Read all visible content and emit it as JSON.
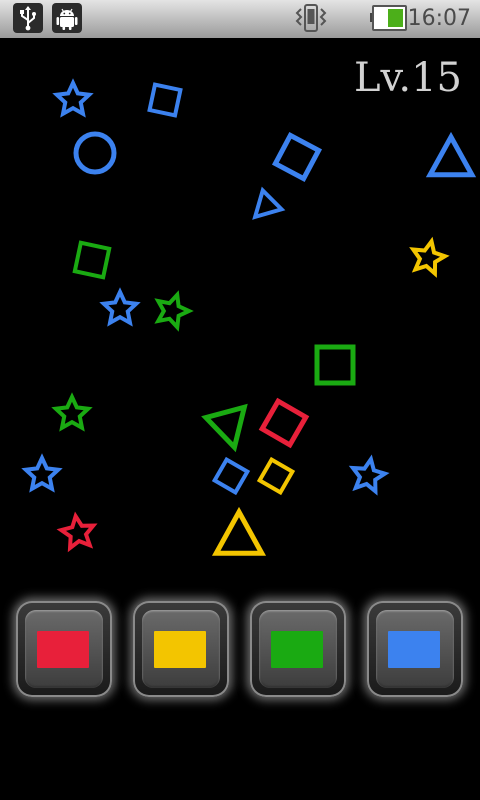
{
  "status_bar": {
    "time": "16:07",
    "icons": [
      "usb-icon",
      "android-debug-icon",
      "vibrate-icon",
      "battery-charging-icon"
    ],
    "battery_color": "#4caf1a"
  },
  "game": {
    "level_text": "Lv.15",
    "colors": {
      "red": "#e8203a",
      "yellow": "#f3c500",
      "green": "#1aaa12",
      "blue": "#3c82ef"
    },
    "shapes": [
      {
        "kind": "star",
        "color": "blue"
      },
      {
        "kind": "square",
        "color": "blue"
      },
      {
        "kind": "circle",
        "color": "blue"
      },
      {
        "kind": "square",
        "color": "blue"
      },
      {
        "kind": "triangle",
        "color": "blue"
      },
      {
        "kind": "triangle",
        "color": "blue"
      },
      {
        "kind": "star",
        "color": "yellow"
      },
      {
        "kind": "square",
        "color": "green"
      },
      {
        "kind": "star",
        "color": "blue"
      },
      {
        "kind": "star",
        "color": "green"
      },
      {
        "kind": "square",
        "color": "green"
      },
      {
        "kind": "star",
        "color": "green"
      },
      {
        "kind": "triangle",
        "color": "green"
      },
      {
        "kind": "square",
        "color": "red"
      },
      {
        "kind": "star",
        "color": "blue"
      },
      {
        "kind": "square",
        "color": "blue"
      },
      {
        "kind": "square",
        "color": "yellow"
      },
      {
        "kind": "star",
        "color": "blue"
      },
      {
        "kind": "star",
        "color": "red"
      },
      {
        "kind": "triangle",
        "color": "yellow"
      }
    ]
  },
  "controls": {
    "buttons": [
      {
        "name": "red",
        "color": "#e8203a"
      },
      {
        "name": "yellow",
        "color": "#f3c500"
      },
      {
        "name": "green",
        "color": "#1aaa12"
      },
      {
        "name": "blue",
        "color": "#3c82ef"
      }
    ]
  }
}
